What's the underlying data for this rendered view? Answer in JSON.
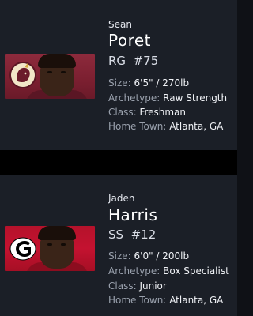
{
  "players": [
    {
      "first_name": "Sean",
      "last_name": "Poret",
      "position": "RG",
      "number": "#75",
      "size_label": "Size:",
      "size_value": "6'5\" / 270lb",
      "archetype_label": "Archetype:",
      "archetype_value": "Raw Strength",
      "class_label": "Class:",
      "class_value": "Freshman",
      "hometown_label": "Home Town:",
      "hometown_value": "Atlanta, GA",
      "team_logo_icon": "seminole-head-logo-icon",
      "accent_color": "#7b1f30"
    },
    {
      "first_name": "Jaden",
      "last_name": "Harris",
      "position": "SS",
      "number": "#12",
      "size_label": "Size:",
      "size_value": "6'0\" / 200lb",
      "archetype_label": "Archetype:",
      "archetype_value": "Box Specialist",
      "class_label": "Class:",
      "class_value": "Junior",
      "hometown_label": "Home Town:",
      "hometown_value": "Atlanta, GA",
      "team_logo_icon": "g-logo-icon",
      "accent_color": "#c41230"
    }
  ]
}
